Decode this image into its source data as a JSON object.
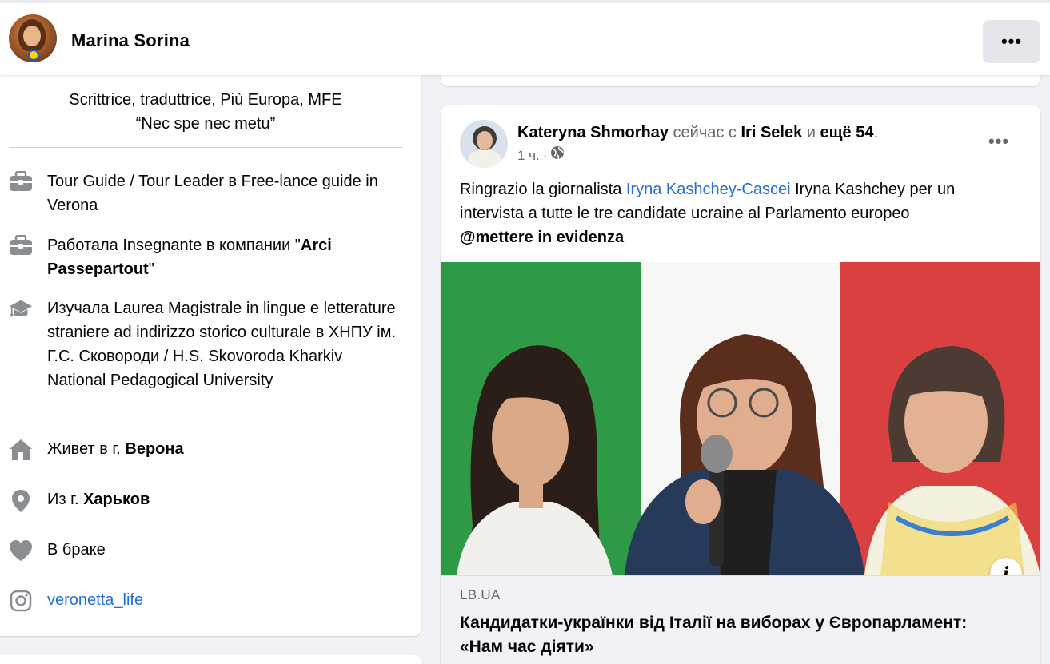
{
  "header": {
    "profile_name": "Marina Sorina",
    "more_label": "•••"
  },
  "intro": {
    "bio_line1": "Scrittrice, traduttrice, Più Europa, MFE",
    "bio_line2": "“Nec spe nec metu”",
    "items": [
      {
        "icon": "briefcase-icon",
        "text": "Tour Guide / Tour Leader в Free-lance guide in Verona"
      },
      {
        "icon": "briefcase-icon",
        "prefix": "Работала Insegnante в компании \"",
        "bold": "Arci Passepartout",
        "suffix": "\""
      },
      {
        "icon": "graduation-cap-icon",
        "text": "Изучала Laurea Magistrale in lingue e letterature straniere ad indirizzo storico culturale в ХНПУ ім. Г.С. Сковороди / H.S. Skovoroda Kharkiv National Pedagogical University"
      },
      {
        "icon": "home-icon",
        "prefix": "Живет в г. ",
        "bold": "Верона"
      },
      {
        "icon": "location-pin-icon",
        "prefix": "Из г. ",
        "bold": "Харьков"
      },
      {
        "icon": "heart-icon",
        "text": "В браке"
      },
      {
        "icon": "instagram-icon",
        "link": "veronetta_life"
      }
    ]
  },
  "post": {
    "author": "Kateryna Shmorhay",
    "with_word": "сейчас с",
    "tagged": "Iri Selek",
    "and_word": "и",
    "others": "ещё 54",
    "time": "1 ч.",
    "separator": "·",
    "privacy_icon": "globe-icon",
    "more_label": "•••",
    "text_before": "Ringrazio la giornalista ",
    "mention": "Iryna Kashchey-Cascei",
    "text_after": " Iryna Kashchey per un intervista a tutte le tre candidate ucraine al Parlamento europeo",
    "tag": "@mettere in evidenza",
    "image_info_label": "i",
    "link_domain": "LB.UA",
    "link_title": "Кандидатки-українки від Італії на виборах у Європарламент: «Нам час діяти»"
  },
  "colors": {
    "link": "#216fdb",
    "flag_green": "#2f9a45",
    "flag_white": "#f7f7f5",
    "flag_red": "#d9403f"
  }
}
